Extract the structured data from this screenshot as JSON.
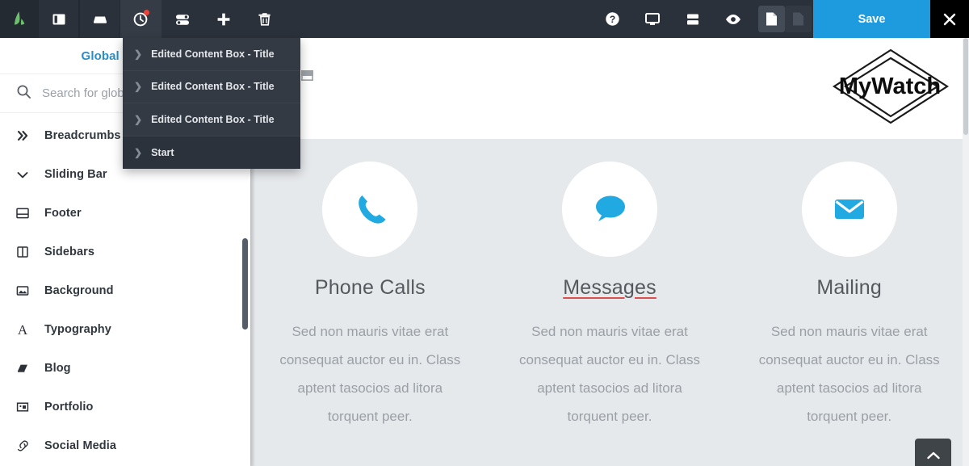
{
  "toolbar": {
    "logo_name": "avada-logo",
    "left_buttons": [
      {
        "name": "layout-panel-icon",
        "title": "Layout Panel"
      },
      {
        "name": "container-icon",
        "title": "Container"
      },
      {
        "name": "history-clock-icon",
        "title": "History",
        "badge": true,
        "active": true
      },
      {
        "name": "toggle-sliders-icon",
        "title": "Settings Toggles"
      },
      {
        "name": "plus-icon",
        "title": "Add Element"
      },
      {
        "name": "trash-icon",
        "title": "Delete"
      }
    ],
    "right_buttons": [
      {
        "name": "help-icon",
        "title": "Help"
      },
      {
        "name": "monitor-icon",
        "title": "Responsive Preview"
      },
      {
        "name": "rows-icon",
        "title": "Rows"
      },
      {
        "name": "eye-icon",
        "title": "Preview"
      }
    ],
    "doc_toggle": [
      {
        "name": "page-document-active-icon",
        "active": true
      },
      {
        "name": "page-document-icon",
        "active": false
      }
    ],
    "save_label": "Save",
    "close_label": "✕",
    "save_color": "#1d9bde",
    "bar_color": "#2b313a"
  },
  "sidebar": {
    "title": "Global Options",
    "title_color": "#2a8fc6",
    "search": {
      "placeholder": "Search for global options",
      "value": ""
    },
    "items": [
      {
        "label": "Breadcrumbs",
        "icon": "double-chevron-right-icon"
      },
      {
        "label": "Sliding Bar",
        "icon": "chevron-down-icon"
      },
      {
        "label": "Footer",
        "icon": "footer-layout-icon"
      },
      {
        "label": "Sidebars",
        "icon": "sidebar-columns-icon"
      },
      {
        "label": "Background",
        "icon": "image-icon"
      },
      {
        "label": "Typography",
        "icon": "letter-a-icon"
      },
      {
        "label": "Blog",
        "icon": "book-icon"
      },
      {
        "label": "Portfolio",
        "icon": "portfolio-frame-icon"
      },
      {
        "label": "Social Media",
        "icon": "link-chain-icon"
      }
    ]
  },
  "dropdown": {
    "items": [
      {
        "label": "Edited Content Box - Title",
        "current": false
      },
      {
        "label": "Edited Content Box - Title",
        "current": false
      },
      {
        "label": "Edited Content Box - Title",
        "current": false
      },
      {
        "label": "Start",
        "current": true
      }
    ]
  },
  "preview": {
    "logo_text": "MyWatch",
    "cart_icon": "shopping-cart-icon",
    "back_to_top_icon": "chevron-up-icon",
    "body_text": "Sed non mauris vitae erat consequat auctor eu in. Class aptent tasocios ad litora torquent peer.",
    "columns": [
      {
        "title": "Phone Calls",
        "icon": "phone-icon",
        "icon_color": "#21a9e1",
        "marked": false,
        "text": "Sed non mauris vitae erat consequat auctor eu in. Class aptent tasocios ad litora torquent peer."
      },
      {
        "title": "Messages",
        "icon": "speech-bubble-icon",
        "icon_color": "#21a9e1",
        "marked": true,
        "text": "Sed non mauris vitae erat consequat auctor eu in. Class aptent tasocios ad litora torquent peer."
      },
      {
        "title": "Mailing",
        "icon": "envelope-icon",
        "icon_color": "#21a9e1",
        "marked": false,
        "text": "Sed non mauris vitae erat consequat auctor eu in. Class aptent tasocios ad litora torquent peer."
      }
    ]
  }
}
